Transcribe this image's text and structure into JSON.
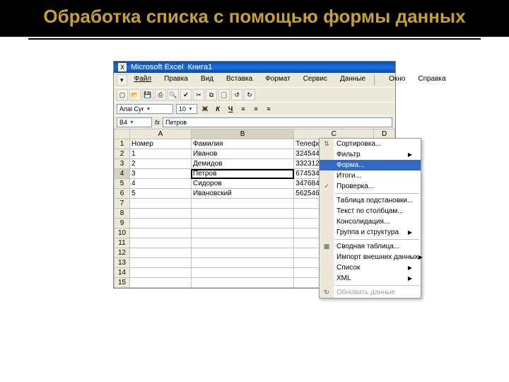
{
  "slide": {
    "title": "Обработка списка с помощью формы данных"
  },
  "titlebar": {
    "app": "Microsoft Excel",
    "doc": "Книга1"
  },
  "menu": {
    "file": "Файл",
    "edit": "Правка",
    "view": "Вид",
    "insert": "Вставка",
    "format": "Формат",
    "tools": "Сервис",
    "data": "Данные",
    "window": "Окно",
    "help": "Справка"
  },
  "font": {
    "name": "Arial Cyr",
    "size": "10"
  },
  "namebox": {
    "cell": "B4",
    "formula": "Петров"
  },
  "columns": [
    "A",
    "B",
    "C",
    "D"
  ],
  "rows_count": 15,
  "data": {
    "1": {
      "A": "Номер",
      "B": "Фамилия",
      "C": "Телефон"
    },
    "2": {
      "A": "1",
      "B": "Иванов",
      "C": "324544"
    },
    "3": {
      "A": "2",
      "B": "Демидов",
      "C": "332312"
    },
    "4": {
      "A": "3",
      "B": "Петров",
      "C": "674534"
    },
    "5": {
      "A": "4",
      "B": "Сидоров",
      "C": "347684"
    },
    "6": {
      "A": "5",
      "B": "Ивановский",
      "C": "562546"
    }
  },
  "selected": {
    "row": "4",
    "col": "B"
  },
  "ctxmenu": [
    {
      "label": "Сортировка...",
      "icon": "⇅"
    },
    {
      "label": "Фильтр",
      "sub": true
    },
    {
      "label": "Форма...",
      "hover": true
    },
    {
      "label": "Итоги..."
    },
    {
      "label": "Проверка...",
      "icon": "✓"
    },
    {
      "divider": true
    },
    {
      "label": "Таблица подстановки..."
    },
    {
      "label": "Текст по столбцам..."
    },
    {
      "label": "Консолидация..."
    },
    {
      "label": "Группа и структура",
      "sub": true
    },
    {
      "divider": true
    },
    {
      "label": "Сводная таблица...",
      "icon": "▦"
    },
    {
      "label": "Импорт внешних данных",
      "sub": true
    },
    {
      "label": "Список",
      "sub": true
    },
    {
      "label": "XML",
      "sub": true
    },
    {
      "divider": true
    },
    {
      "label": "Обновить данные",
      "disabled": true,
      "icon": "↻"
    }
  ]
}
